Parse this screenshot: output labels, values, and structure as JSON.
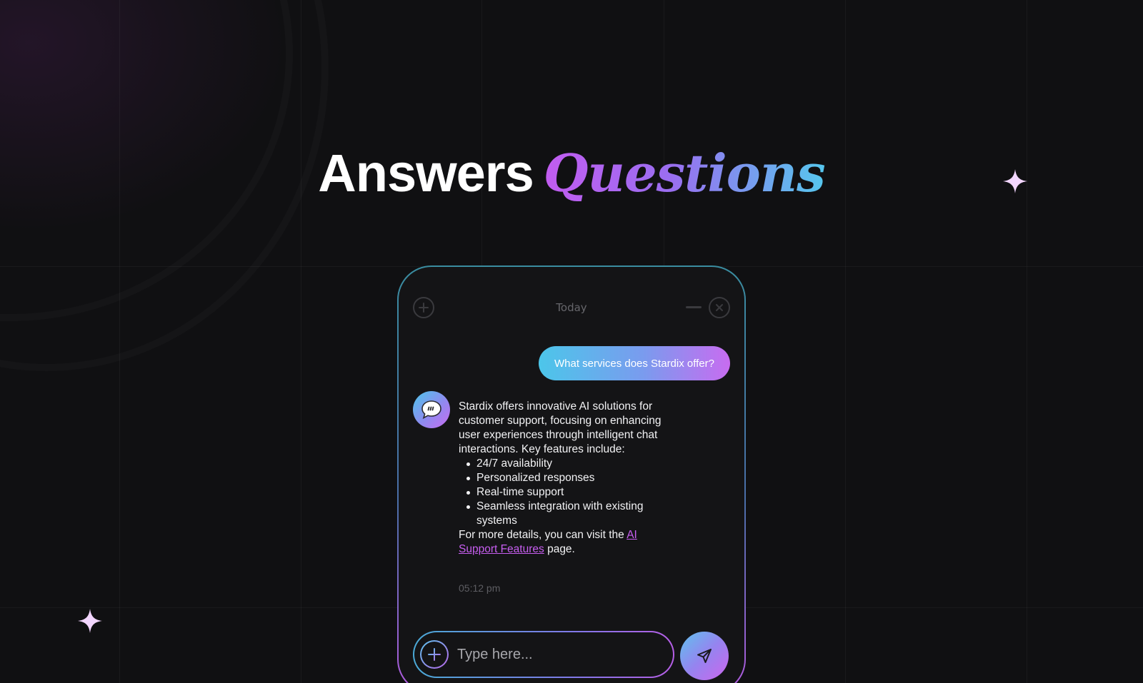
{
  "headline": {
    "plain": "Answers",
    "fancy": "Questions"
  },
  "chat_window": {
    "date_label": "Today",
    "user_message": "What services does Stardix offer?",
    "bot_reply": {
      "intro": "Stardix offers innovative AI solutions for customer support, focusing on enhancing user experiences through intelligent chat interactions. Key features include:",
      "features": [
        "24/7 availability",
        "Personalized responses",
        "Real-time support",
        "Seamless integration with existing systems"
      ],
      "outro_before_link": "For more details, you can visit the ",
      "link_text": "AI Support Features",
      "outro_after_link": " page.",
      "timestamp": "05:12 pm"
    },
    "composer": {
      "placeholder": "Type here..."
    }
  },
  "icons": [
    "plus-icon",
    "minimize-icon",
    "close-icon",
    "chat-bubble-icon",
    "send-icon",
    "sparkle-icon"
  ],
  "colors": {
    "background": "#101012",
    "gradient_purple": "#c25cf0",
    "gradient_blue": "#56c7ee",
    "link": "#c75ef0",
    "sparkle": "#f3d6ff"
  }
}
